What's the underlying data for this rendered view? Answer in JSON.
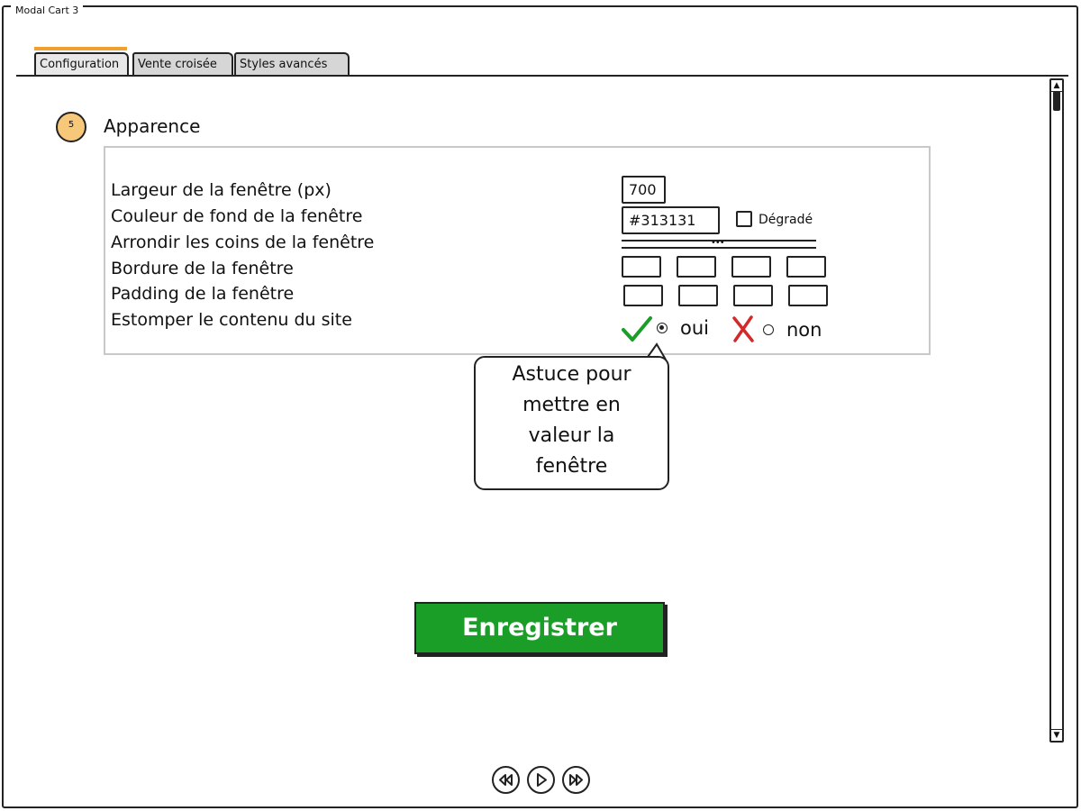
{
  "window": {
    "title": "Modal Cart 3"
  },
  "tabs": [
    {
      "label": "Configuration",
      "active": true
    },
    {
      "label": "Vente croisée",
      "active": false
    },
    {
      "label": "Styles avancés",
      "active": false
    }
  ],
  "step": {
    "number": "5",
    "title": "Apparence"
  },
  "form": {
    "labels": [
      "Largeur de la fenêtre (px)",
      "Couleur de fond de la fenêtre",
      "Arrondir les coins de la fenêtre",
      "Bordure de la fenêtre",
      "Padding de la fenêtre",
      "Estomper le contenu du site"
    ],
    "width_value": "700",
    "bg_color_value": "#313131",
    "gradient_label": "Dégradé",
    "slider_dots": "•••",
    "blur_yes_label": "oui",
    "blur_no_label": "non"
  },
  "tooltip": {
    "text_lines": [
      "Astuce pour",
      "mettre en",
      "valeur la",
      "fenêtre"
    ]
  },
  "save_button": {
    "label": "Enregistrer"
  },
  "icons": {
    "check": "check-icon",
    "cross": "x-icon",
    "scroll_up": "chevron-up-icon",
    "scroll_down": "chevron-down-icon",
    "rewind": "rewind-icon",
    "play": "play-icon",
    "forward": "fast-forward-icon"
  },
  "colors": {
    "accent_tab": "#f0a030",
    "step_badge": "#f7c77a",
    "save_button": "#1a9e28",
    "check": "#1a9e28",
    "cross": "#d22a2a"
  }
}
